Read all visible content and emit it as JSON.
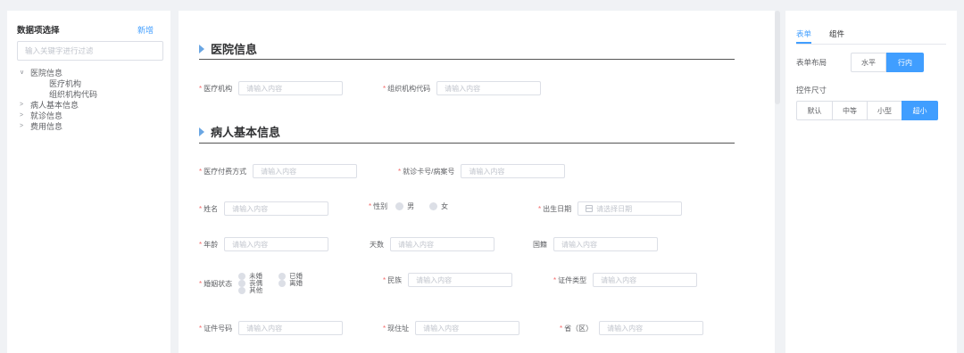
{
  "left": {
    "title": "数据项选择",
    "add": "新增",
    "search_placeholder": "输入关键字进行过滤",
    "tree": [
      {
        "label": "医院信息",
        "expanded": true,
        "children": [
          "医疗机构",
          "组织机构代码"
        ]
      },
      {
        "label": "病人基本信息",
        "expanded": false
      },
      {
        "label": "就诊信息",
        "expanded": false
      },
      {
        "label": "费用信息",
        "expanded": false
      }
    ]
  },
  "sections": {
    "hospital": "医院信息",
    "patient": "病人基本信息"
  },
  "fields": {
    "org": {
      "label": "医疗机构",
      "placeholder": "请输入内容"
    },
    "org_code": {
      "label": "组织机构代码",
      "placeholder": "请输入内容"
    },
    "pay_method": {
      "label": "医疗付费方式",
      "placeholder": "请输入内容"
    },
    "card_no": {
      "label": "就诊卡号/病案号",
      "placeholder": "请输入内容"
    },
    "name": {
      "label": "姓名",
      "placeholder": "请输入内容"
    },
    "gender": {
      "label": "性别",
      "options": [
        "男",
        "女"
      ]
    },
    "birth": {
      "label": "出生日期",
      "placeholder": "请选择日期"
    },
    "age": {
      "label": "年龄",
      "placeholder": "请输入内容"
    },
    "days": {
      "label": "天数",
      "placeholder": "请输入内容"
    },
    "nationality": {
      "label": "国籍",
      "placeholder": "请输入内容"
    },
    "marriage": {
      "label": "婚姻状态",
      "options": [
        "未婚",
        "已婚",
        "丧偶",
        "离婚",
        "其他"
      ]
    },
    "ethnic": {
      "label": "民族",
      "placeholder": "请输入内容"
    },
    "id_type": {
      "label": "证件类型",
      "placeholder": "请输入内容"
    },
    "id_no": {
      "label": "证件号码",
      "placeholder": "请输入内容"
    },
    "address": {
      "label": "现住址",
      "placeholder": "请输入内容"
    },
    "province": {
      "label": "省（区）",
      "placeholder": "请输入内容"
    }
  },
  "right": {
    "tabs": [
      "表单",
      "组件"
    ],
    "layout_label": "表单布局",
    "layout_options": [
      "水平",
      "行内"
    ],
    "size_label": "控件尺寸",
    "size_options": [
      "默认",
      "中等",
      "小型",
      "超小"
    ]
  },
  "colors": {
    "accent": "#409eff",
    "section_marker": "#6aa6e3"
  }
}
